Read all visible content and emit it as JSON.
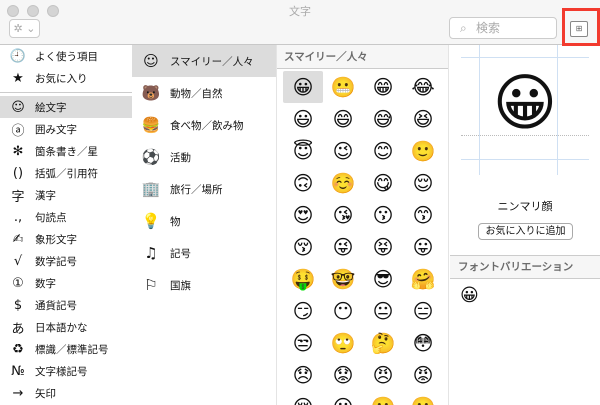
{
  "window": {
    "title": "文字"
  },
  "toolbar": {
    "gear_label": "✲ ⌄",
    "search_placeholder": "検索"
  },
  "sidebar": {
    "items": [
      {
        "icon": "🕘",
        "label": "よく使う項目"
      },
      {
        "icon": "★",
        "label": "お気に入り"
      },
      {
        "icon": "☺",
        "label": "絵文字"
      },
      {
        "icon": "ⓐ",
        "label": "囲み文字"
      },
      {
        "icon": "✻",
        "label": "箇条書き／星"
      },
      {
        "icon": "()",
        "label": "括弧／引用符"
      },
      {
        "icon": "字",
        "label": "漢字"
      },
      {
        "icon": ".,",
        "label": "句読点"
      },
      {
        "icon": "✍",
        "label": "象形文字"
      },
      {
        "icon": "√",
        "label": "数学記号"
      },
      {
        "icon": "①",
        "label": "数字"
      },
      {
        "icon": "$",
        "label": "通貨記号"
      },
      {
        "icon": "あ",
        "label": "日本語かな"
      },
      {
        "icon": "♻",
        "label": "標識／標準記号"
      },
      {
        "icon": "№",
        "label": "文字様記号"
      },
      {
        "icon": "→",
        "label": "矢印"
      }
    ]
  },
  "categories": [
    {
      "icon": "☺",
      "label": "スマイリー／人々"
    },
    {
      "icon": "🐻",
      "label": "動物／自然"
    },
    {
      "icon": "🍔",
      "label": "食べ物／飲み物"
    },
    {
      "icon": "⚽",
      "label": "活動"
    },
    {
      "icon": "🏢",
      "label": "旅行／場所"
    },
    {
      "icon": "💡",
      "label": "物"
    },
    {
      "icon": "♫",
      "label": "記号"
    },
    {
      "icon": "⚐",
      "label": "国旗"
    }
  ],
  "grid": {
    "header": "スマイリー／人々",
    "rows": [
      [
        "😀",
        "😬",
        "😁",
        "😂"
      ],
      [
        "😃",
        "😄",
        "😅",
        "😆"
      ],
      [
        "😇",
        "😉",
        "😊",
        "🙂"
      ],
      [
        "🙃",
        "☺️",
        "😋",
        "😌"
      ],
      [
        "😍",
        "😘",
        "😗",
        "😙"
      ],
      [
        "😚",
        "😜",
        "😝",
        "😛"
      ],
      [
        "🤑",
        "🤓",
        "😎",
        "🤗"
      ],
      [
        "😏",
        "😶",
        "😐",
        "😑"
      ],
      [
        "😒",
        "🙄",
        "🤔",
        "😳"
      ],
      [
        "😞",
        "😟",
        "😠",
        "😡"
      ],
      [
        "😔",
        "😕",
        "🙁",
        "☹️"
      ]
    ]
  },
  "detail": {
    "emoji": "😀",
    "name": "ニンマリ顔",
    "favorite_button": "お気に入りに追加",
    "font_variation_header": "フォントバリエーション",
    "variation": "😀"
  }
}
